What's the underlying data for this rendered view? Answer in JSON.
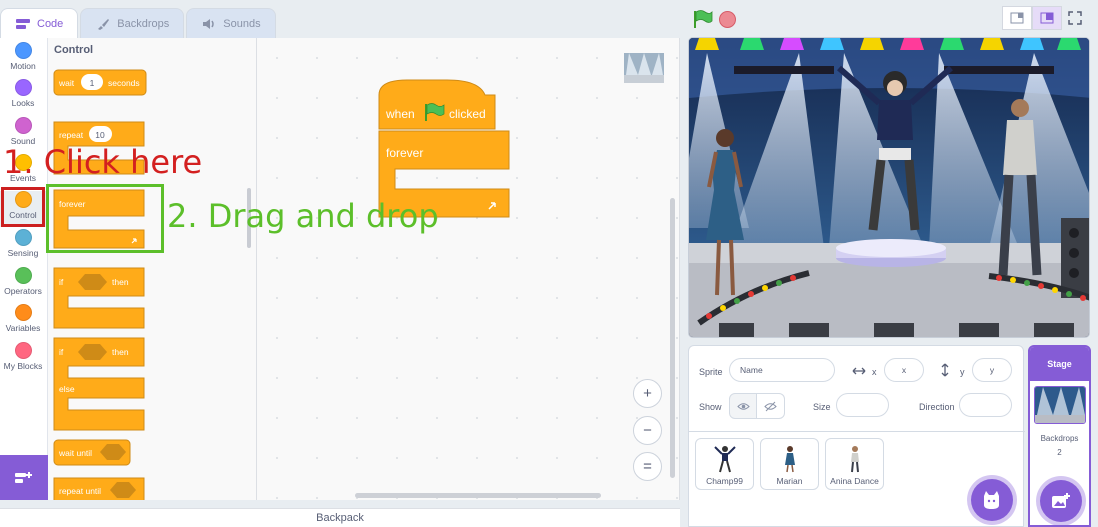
{
  "tabs": {
    "code": "Code",
    "backdrops": "Backdrops",
    "sounds": "Sounds"
  },
  "categories": [
    {
      "label": "Motion",
      "color": "#4c97ff"
    },
    {
      "label": "Looks",
      "color": "#9966ff"
    },
    {
      "label": "Sound",
      "color": "#cf63cf"
    },
    {
      "label": "Events",
      "color": "#ffbf00"
    },
    {
      "label": "Control",
      "color": "#ffab19"
    },
    {
      "label": "Sensing",
      "color": "#5cb1d6"
    },
    {
      "label": "Operators",
      "color": "#59c059"
    },
    {
      "label": "Variables",
      "color": "#ff8c1a"
    },
    {
      "label": "My Blocks",
      "color": "#ff6680"
    }
  ],
  "palette": {
    "title": "Control",
    "wait_label": "wait",
    "wait_value": "1",
    "wait_unit": "seconds",
    "repeat_label": "repeat",
    "repeat_value": "10",
    "forever_label": "forever",
    "if_label": "if",
    "then_label": "then",
    "else_label": "else",
    "wait_until_label": "wait until",
    "repeat_until_label": "repeat until"
  },
  "script": {
    "when_label": "when",
    "clicked_label": "clicked",
    "forever_label": "forever"
  },
  "zoom": {
    "in": "+",
    "out": "−",
    "reset": "="
  },
  "backpack_label": "Backpack",
  "sprite_info": {
    "sprite_label": "Sprite",
    "name_placeholder": "Name",
    "x_label": "x",
    "x_placeholder": "x",
    "y_label": "y",
    "y_placeholder": "y",
    "show_label": "Show",
    "size_label": "Size",
    "direction_label": "Direction"
  },
  "sprites": [
    {
      "name": "Champ99"
    },
    {
      "name": "Marian"
    },
    {
      "name": "Anina Dance"
    }
  ],
  "stage_panel": {
    "title": "Stage",
    "backdrops_label": "Backdrops",
    "backdrops_count": "2"
  },
  "annotations": {
    "step1": "1. Click here",
    "step2": "2. Drag and drop"
  },
  "colors": {
    "accent": "#855cd6",
    "control": "#ffab19",
    "control_border": "#cf8b17",
    "annotation_red": "#d32020",
    "annotation_green": "#5cbf2a"
  }
}
